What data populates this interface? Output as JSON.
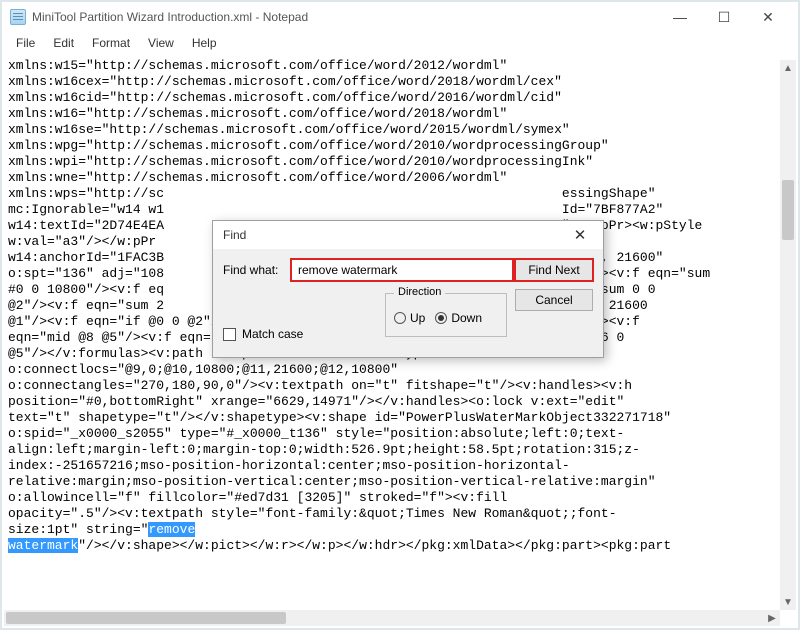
{
  "window": {
    "title": "MiniTool Partition Wizard Introduction.xml - Notepad"
  },
  "menus": [
    "File",
    "Edit",
    "Format",
    "View",
    "Help"
  ],
  "find": {
    "title": "Find",
    "findwhat_label": "Find what:",
    "findwhat_value": "remove watermark",
    "find_next": "Find Next",
    "cancel": "Cancel",
    "matchcase": "Match case",
    "direction_label": "Direction",
    "up": "Up",
    "down": "Down",
    "direction_selected": "down"
  },
  "highlighted_text": "remove watermark",
  "xml_lines": [
    "xmlns:w15=\"http://schemas.microsoft.com/office/word/2012/wordml\"",
    "xmlns:w16cex=\"http://schemas.microsoft.com/office/word/2018/wordml/cex\"",
    "xmlns:w16cid=\"http://schemas.microsoft.com/office/word/2016/wordml/cid\"",
    "xmlns:w16=\"http://schemas.microsoft.com/office/word/2018/wordml\"",
    "xmlns:w16se=\"http://schemas.microsoft.com/office/word/2015/wordml/symex\"",
    "xmlns:wpg=\"http://schemas.microsoft.com/office/word/2010/wordprocessingGroup\"",
    "xmlns:wpi=\"http://schemas.microsoft.com/office/word/2010/wordprocessingInk\"",
    "xmlns:wne=\"http://schemas.microsoft.com/office/word/2006/wordml\"",
    "xmlns:wps=\"http://sc                                                   essingShape\"",
    "mc:Ignorable=\"w14 w1                                                   Id=\"7BF877A2\"",
    "w14:textId=\"2D74E4EA                                                   \"><w:pPr><w:pStyle",
    "w:val=\"a3\"/></w:pPr                                                   ",
    "w14:anchorId=\"1FAC3B                                                   21600, 21600\"",
    "o:spt=\"136\" adj=\"108                                                   mulas><v:f eqn=\"sum",
    "#0 0 10800\"/><v:f eq                                                   eqn=\"sum 0 0",
    "@2\"/><v:f eqn=\"sum 2                                                   if @0 21600",
    "@1\"/><v:f eqn=\"if @0 0 @2\"/><v:f eqn=\"if @0 @4 21600\"/><v:f eqn=\"mid @5 @6\"/><v:f",
    "eqn=\"mid @8 @5\"/><v:f eqn=\"mid @7 @8\"/><v:f eqn=\"mid @6 @7\"/><v:f eqn=\"sum @6 0",
    "@5\"/></v:formulas><v:path textpathok=\"t\" o:connecttype=\"custom\"",
    "o:connectlocs=\"@9,0;@10,10800;@11,21600;@12,10800\"",
    "o:connectangles=\"270,180,90,0\"/><v:textpath on=\"t\" fitshape=\"t\"/><v:handles><v:h",
    "position=\"#0,bottomRight\" xrange=\"6629,14971\"/></v:handles><o:lock v:ext=\"edit\"",
    "text=\"t\" shapetype=\"t\"/></v:shapetype><v:shape id=\"PowerPlusWaterMarkObject332271718\"",
    "o:spid=\"_x0000_s2055\" type=\"#_x0000_t136\" style=\"position:absolute;left:0;text-",
    "align:left;margin-left:0;margin-top:0;width:526.9pt;height:58.5pt;rotation:315;z-",
    "index:-251657216;mso-position-horizontal:center;mso-position-horizontal-",
    "relative:margin;mso-position-vertical:center;mso-position-vertical-relative:margin\"",
    "o:allowincell=\"f\" fillcolor=\"#ed7d31 [3205]\" stroked=\"f\"><v:fill",
    "opacity=\".5\"/><v:textpath style=\"font-family:&quot;Times New Roman&quot;;font-",
    "size:1pt\" string=\"",
    "\"/></v:shape></w:pict></w:r></w:p></w:hdr></pkg:xmlData></pkg:part><pkg:part"
  ]
}
